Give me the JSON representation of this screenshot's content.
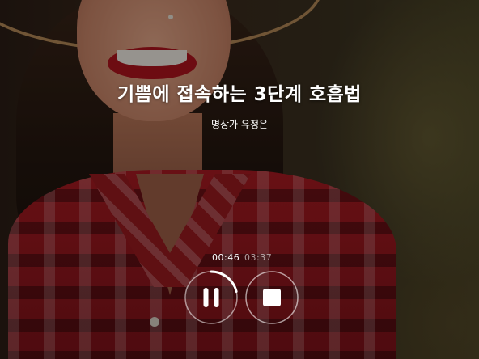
{
  "player": {
    "title": "기쁨에 접속하는 3단계 호흡법",
    "subtitle": "명상가 유정은",
    "elapsed": "00:46",
    "total": "03:37",
    "progress": 0.212,
    "controls": {
      "pause_icon": "pause-icon",
      "stop_icon": "stop-icon"
    },
    "colors": {
      "text": "#ffffff",
      "ring": "#ffffff",
      "overlay": "rgba(0,0,0,0.38)"
    }
  }
}
